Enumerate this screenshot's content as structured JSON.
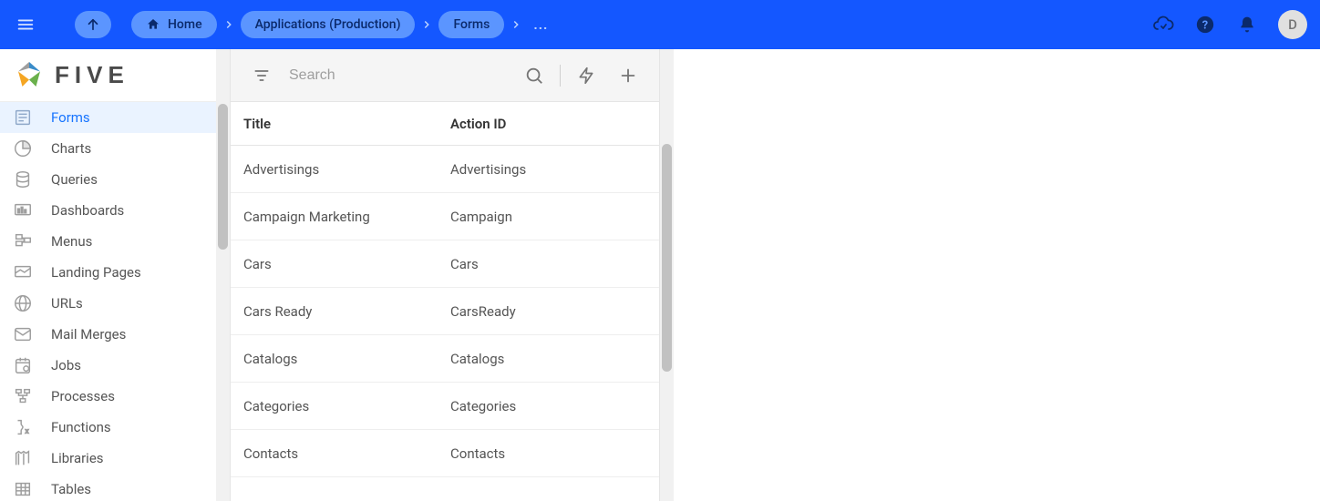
{
  "header": {
    "breadcrumbs": [
      {
        "label": "Home"
      },
      {
        "label": "Applications (Production)"
      },
      {
        "label": "Forms"
      }
    ],
    "overflow": "...",
    "avatar_initial": "D"
  },
  "logo_text": "FIVE",
  "sidebar": {
    "items": [
      {
        "label": "Forms",
        "active": true
      },
      {
        "label": "Charts"
      },
      {
        "label": "Queries"
      },
      {
        "label": "Dashboards"
      },
      {
        "label": "Menus"
      },
      {
        "label": "Landing Pages"
      },
      {
        "label": "URLs"
      },
      {
        "label": "Mail Merges"
      },
      {
        "label": "Jobs"
      },
      {
        "label": "Processes"
      },
      {
        "label": "Functions"
      },
      {
        "label": "Libraries"
      },
      {
        "label": "Tables"
      }
    ]
  },
  "panel": {
    "search_placeholder": "Search",
    "columns": {
      "title": "Title",
      "action_id": "Action ID"
    },
    "rows": [
      {
        "title": "Advertisings",
        "action_id": "Advertisings"
      },
      {
        "title": "Campaign Marketing",
        "action_id": "Campaign"
      },
      {
        "title": "Cars",
        "action_id": "Cars"
      },
      {
        "title": "Cars Ready",
        "action_id": "CarsReady"
      },
      {
        "title": "Catalogs",
        "action_id": "Catalogs"
      },
      {
        "title": "Categories",
        "action_id": "Categories"
      },
      {
        "title": "Contacts",
        "action_id": "Contacts"
      }
    ]
  }
}
